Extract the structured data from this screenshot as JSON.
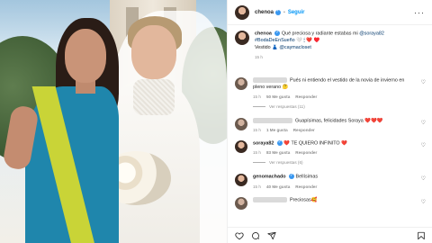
{
  "post": {
    "author": "chenoa",
    "follow_label": "Seguir",
    "more_label": "···"
  },
  "caption": {
    "author": "chenoa",
    "text_1": "Qué preciosa y radiante estabas mi",
    "mention_1": "@soraya82",
    "text_2": "#BodaDeEnSueño 🤍 🕯 ❤️ ♥️",
    "text_3": "Vestido 👗",
    "mention_2": "@caymacloset",
    "time": "15 h"
  },
  "comments": [
    {
      "text": "Pués ni entiendo el vestido de la novia de invierno en pleno verano 🤔",
      "time": "15 h",
      "likes": "50 Me gusta",
      "reply": "Responder",
      "replies": "Ver respuestas (11)"
    },
    {
      "text": "Guapísimas, felicidades Soraya ❤️❤️❤️",
      "time": "15 h",
      "likes": "1 Me gusta",
      "reply": "Responder"
    },
    {
      "author": "soraya82",
      "text": "❤️ TE QUIERO INFINITO ❤️",
      "time": "15 h",
      "likes": "83 Me gusta",
      "reply": "Responder",
      "replies": "Ver respuestas (6)"
    },
    {
      "author": "genomachado",
      "text": "Bellísimas",
      "time": "15 h",
      "likes": "40 Me gusta",
      "reply": "Responder"
    },
    {
      "text": "Preciosas🥰",
      "time": "",
      "likes": "",
      "reply": ""
    }
  ],
  "icons": {
    "like": "heart-icon",
    "comment": "comment-icon",
    "share": "share-icon",
    "save": "bookmark-icon"
  }
}
